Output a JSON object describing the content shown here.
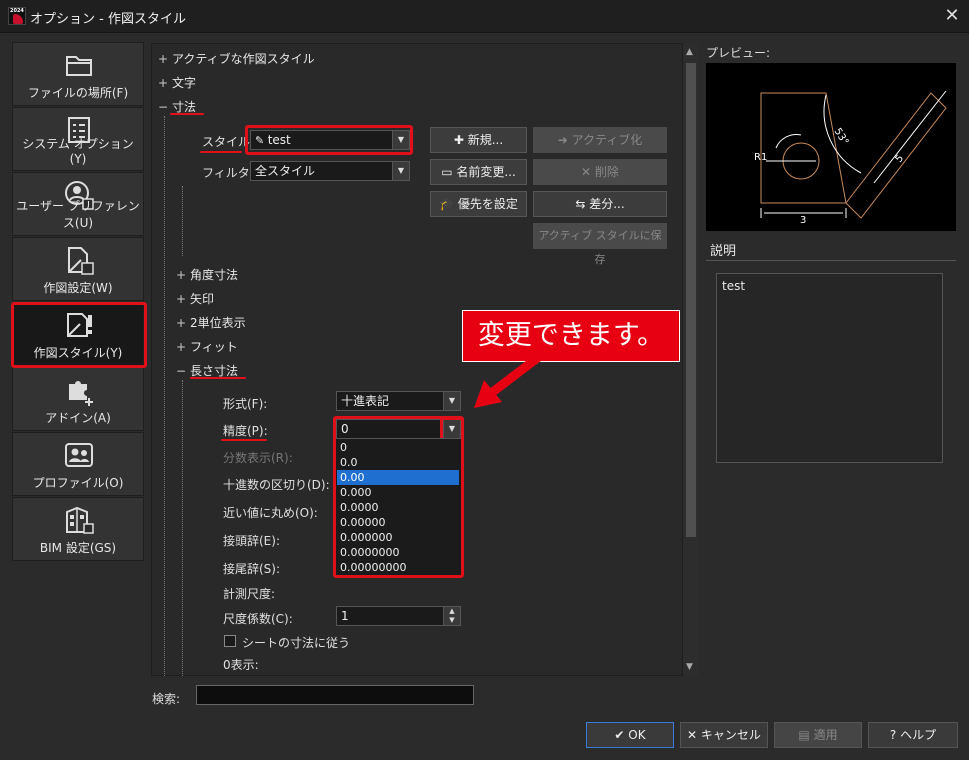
{
  "window": {
    "title": "オプション - 作図スタイル",
    "logo_year": "2024",
    "close_glyph": "✕"
  },
  "sidebar": {
    "items": [
      {
        "label": "ファイルの場所(F)",
        "icon": "folder-icon"
      },
      {
        "label": "システム オプション (Y)",
        "icon": "checklist-icon"
      },
      {
        "label": "ユーザー プリファレンス(U)",
        "icon": "user-settings-icon"
      },
      {
        "label": "作図設定(W)",
        "icon": "drawing-settings-icon"
      },
      {
        "label": "作図スタイル(Y)",
        "icon": "drawing-style-icon"
      },
      {
        "label": "アドイン(A)",
        "icon": "puzzle-icon"
      },
      {
        "label": "プロファイル(O)",
        "icon": "profile-icon"
      },
      {
        "label": "BIM 設定(GS)",
        "icon": "bim-building-icon"
      }
    ],
    "active_index": 4
  },
  "tree": {
    "active_style": {
      "sign": "+",
      "label": "アクティブな作図スタイル"
    },
    "text": {
      "sign": "+",
      "label": "文字"
    },
    "dimension": {
      "sign": "−",
      "label": "寸法"
    },
    "style_label": "スタイル:",
    "style_value": "test",
    "filter_label": "フィルタ:",
    "filter_value": "全スタイル",
    "buttons": {
      "new": "新規...",
      "activate": "アクティブ化",
      "rename": "名前変更...",
      "delete": "削除",
      "set_priority": "優先を設定",
      "diff": "差分...",
      "save_active": "アクティブ スタイルに保存"
    },
    "children": [
      {
        "sign": "+",
        "label": "角度寸法"
      },
      {
        "sign": "+",
        "label": "矢印"
      },
      {
        "sign": "+",
        "label": "2単位表示"
      },
      {
        "sign": "+",
        "label": "フィット"
      }
    ],
    "linear": {
      "sign": "−",
      "label": "長さ寸法"
    },
    "fields": {
      "format_label": "形式(F):",
      "format_value": "十進表記",
      "precision_label": "精度(P):",
      "precision_value": "0",
      "fraction_label": "分数表示(R):",
      "decimal_sep_label": "十進数の区切り(D):",
      "round_label": "近い値に丸め(O):",
      "prefix_label": "接頭辞(E):",
      "suffix_label": "接尾辞(S):",
      "measure_scale_label": "計測尺度:",
      "scale_factor_label": "尺度係数(C):",
      "scale_factor_value": "1",
      "follow_sheet_label": "シートの寸法に従う",
      "zero_display_label": "0表示:"
    },
    "precision_options": [
      "0",
      "0.0",
      "0.00",
      "0.000",
      "0.0000",
      "0.00000",
      "0.000000",
      "0.0000000",
      "0.00000000"
    ],
    "precision_selected_index": 2
  },
  "callout": {
    "text": "変更できます。"
  },
  "preview": {
    "label": "プレビュー:",
    "dims": {
      "radius": "R1",
      "angle": "53°",
      "diag": "5",
      "bottom": "3"
    }
  },
  "description": {
    "label": "説明",
    "text": "test"
  },
  "search": {
    "label": "検索:",
    "value": ""
  },
  "footer": {
    "ok": "OK",
    "cancel": "キャンセル",
    "apply": "適用",
    "help": "ヘルプ"
  },
  "colors": {
    "accent_red": "#e0101a",
    "selection_blue": "#1e6fd0",
    "preview_line": "#c88a5a"
  }
}
